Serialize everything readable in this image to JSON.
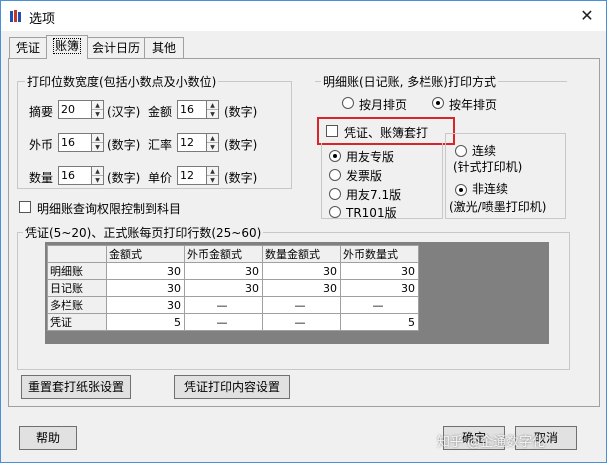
{
  "window": {
    "title": "选项",
    "close_glyph": "✕"
  },
  "tabs": [
    {
      "label": "凭证",
      "active": false
    },
    {
      "label": "账簿",
      "active": true
    },
    {
      "label": "会计日历",
      "active": false
    },
    {
      "label": "其他",
      "active": false
    }
  ],
  "print_width": {
    "legend": "打印位数宽度(包括小数点及小数位)",
    "rows": [
      {
        "label1": "摘要",
        "value1": "20",
        "unit1": "(汉字)",
        "label2": "金额",
        "value2": "16",
        "unit2": "(数字)"
      },
      {
        "label1": "外币",
        "value1": "16",
        "unit1": "(数字)",
        "label2": "汇率",
        "value2": "12",
        "unit2": "(数字)"
      },
      {
        "label1": "数量",
        "value1": "16",
        "unit1": "(数字)",
        "label2": "单价",
        "value2": "12",
        "unit2": "(数字)"
      }
    ]
  },
  "detail_print": {
    "legend": "明细账(日记账, 多栏账)打印方式",
    "by_month": "按月排页",
    "by_year": "按年排页",
    "selected": "by_year"
  },
  "voucher_book_overprint": {
    "label": "凭证、账簿套打",
    "checked": false
  },
  "overprint_type": {
    "options": [
      "用友专版",
      "发票版",
      "用友7.1版",
      "TR101版"
    ],
    "selected": 0
  },
  "printer_type": {
    "continuous": "连续",
    "continuous_sub": "(针式打印机)",
    "noncontinuous": "非连续",
    "noncontinuous_sub": "(激光/喷墨打印机)",
    "selected": "noncontinuous"
  },
  "query_permission": {
    "label": "明细账查询权限控制到科目",
    "checked": false
  },
  "lines_per_page": {
    "legend": "凭证(5~20)、正式账每页打印行数(25~60)",
    "columns": [
      "",
      "金额式",
      "外币金额式",
      "数量金额式",
      "外币数量式"
    ],
    "rows": [
      {
        "name": "明细账",
        "cells": [
          "30",
          "30",
          "30",
          "30"
        ]
      },
      {
        "name": "日记账",
        "cells": [
          "30",
          "30",
          "30",
          "30"
        ]
      },
      {
        "name": "多栏账",
        "cells": [
          "30",
          "—",
          "—",
          "—"
        ]
      },
      {
        "name": "凭证",
        "cells": [
          "5",
          "—",
          "—",
          "5"
        ]
      }
    ]
  },
  "buttons": {
    "reset_overprint": "重置套打纸张设置",
    "voucher_print_content": "凭证打印内容设置",
    "help": "帮助",
    "ok": "确定",
    "cancel": "取消"
  },
  "watermark": "知乎 @企通数字化"
}
